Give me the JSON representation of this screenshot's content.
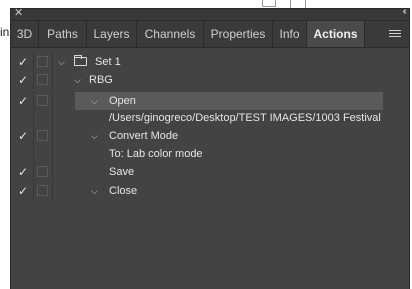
{
  "background": {
    "fragment_text": "in"
  },
  "panel": {
    "close_glyph": "✕",
    "collapse_glyph": "‹‹",
    "tabs": [
      {
        "label": "3D"
      },
      {
        "label": "Paths"
      },
      {
        "label": "Layers"
      },
      {
        "label": "Channels"
      },
      {
        "label": "Properties"
      },
      {
        "label": "Info"
      },
      {
        "label": "Actions",
        "active": true
      }
    ],
    "menu_icon": "hamburger-icon"
  },
  "actions": {
    "rows": [
      {
        "check": "✓",
        "chevron": "⌵",
        "label": "Set 1",
        "icon": "folder-icon"
      },
      {
        "check": "✓",
        "chevron": "⌵",
        "label": "RBG"
      },
      {
        "check": "✓",
        "chevron": "⌵",
        "label": "Open",
        "selected": true
      },
      {
        "check": "",
        "chevron": "",
        "label": "/Users/ginogreco/Desktop/TEST IMAGES/1003 Festival ..."
      },
      {
        "check": "✓",
        "chevron": "⌵",
        "label": "Convert Mode"
      },
      {
        "check": "",
        "chevron": "",
        "label": "To: Lab color mode"
      },
      {
        "check": "✓",
        "chevron": "",
        "label": "Save"
      },
      {
        "check": "✓",
        "chevron": "⌵",
        "label": "Close"
      }
    ]
  },
  "colors": {
    "panel_bg": "#434343",
    "tab_bar": "#3a3a3a",
    "active_tab": "#4a4a4a",
    "selected_row": "#5a5a5a",
    "text": "#e6e6e6"
  }
}
